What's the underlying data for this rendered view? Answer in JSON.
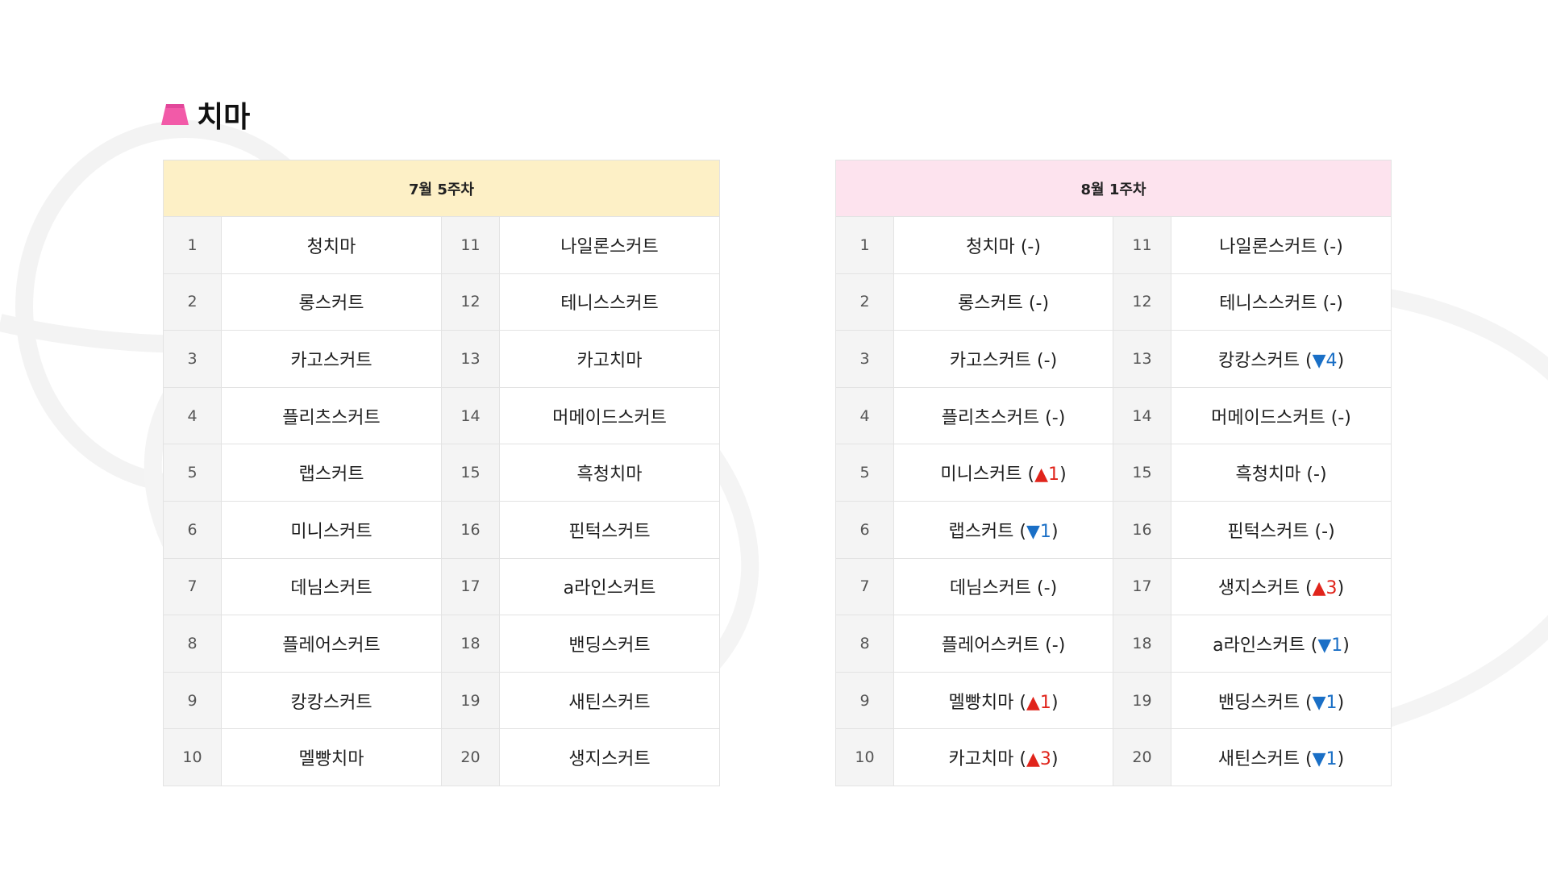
{
  "section": {
    "title": "치마",
    "icon": "skirt-icon",
    "icon_color": "#f25aa8"
  },
  "colors": {
    "left_header_bg": "#fdf0c6",
    "right_header_bg": "#fde3ee",
    "up": "#e0241b",
    "down": "#1a6fc6"
  },
  "left_table": {
    "header": "7월 5주차",
    "rows": [
      {
        "rank_a": "1",
        "name_a": "청치마",
        "rank_b": "11",
        "name_b": "나일론스커트"
      },
      {
        "rank_a": "2",
        "name_a": "롱스커트",
        "rank_b": "12",
        "name_b": "테니스스커트"
      },
      {
        "rank_a": "3",
        "name_a": "카고스커트",
        "rank_b": "13",
        "name_b": "카고치마"
      },
      {
        "rank_a": "4",
        "name_a": "플리츠스커트",
        "rank_b": "14",
        "name_b": "머메이드스커트"
      },
      {
        "rank_a": "5",
        "name_a": "랩스커트",
        "rank_b": "15",
        "name_b": "흑청치마"
      },
      {
        "rank_a": "6",
        "name_a": "미니스커트",
        "rank_b": "16",
        "name_b": "핀턱스커트"
      },
      {
        "rank_a": "7",
        "name_a": "데님스커트",
        "rank_b": "17",
        "name_b": "a라인스커트"
      },
      {
        "rank_a": "8",
        "name_a": "플레어스커트",
        "rank_b": "18",
        "name_b": "밴딩스커트"
      },
      {
        "rank_a": "9",
        "name_a": "캉캉스커트",
        "rank_b": "19",
        "name_b": "새틴스커트"
      },
      {
        "rank_a": "10",
        "name_a": "멜빵치마",
        "rank_b": "20",
        "name_b": "생지스커트"
      }
    ]
  },
  "right_table": {
    "header": "8월 1주차",
    "rows": [
      {
        "rank_a": "1",
        "name_a": "청치마",
        "chg_a": "(-)",
        "dir_a": "none",
        "rank_b": "11",
        "name_b": "나일론스커트",
        "chg_b": "(-)",
        "dir_b": "none"
      },
      {
        "rank_a": "2",
        "name_a": "롱스커트",
        "chg_a": "(-)",
        "dir_a": "none",
        "rank_b": "12",
        "name_b": "테니스스커트",
        "chg_b": "(-)",
        "dir_b": "none"
      },
      {
        "rank_a": "3",
        "name_a": "카고스커트",
        "chg_a": "(-)",
        "dir_a": "none",
        "rank_b": "13",
        "name_b": "캉캉스커트",
        "chg_b": "▼4",
        "dir_b": "down"
      },
      {
        "rank_a": "4",
        "name_a": "플리츠스커트",
        "chg_a": "(-)",
        "dir_a": "none",
        "rank_b": "14",
        "name_b": "머메이드스커트",
        "chg_b": "(-)",
        "dir_b": "none"
      },
      {
        "rank_a": "5",
        "name_a": "미니스커트",
        "chg_a": "▲1",
        "dir_a": "up",
        "rank_b": "15",
        "name_b": "흑청치마",
        "chg_b": "(-)",
        "dir_b": "none"
      },
      {
        "rank_a": "6",
        "name_a": "랩스커트",
        "chg_a": "▼1",
        "dir_a": "down",
        "rank_b": "16",
        "name_b": "핀턱스커트",
        "chg_b": "(-)",
        "dir_b": "none"
      },
      {
        "rank_a": "7",
        "name_a": "데님스커트",
        "chg_a": "(-)",
        "dir_a": "none",
        "rank_b": "17",
        "name_b": "생지스커트",
        "chg_b": "▲3",
        "dir_b": "up"
      },
      {
        "rank_a": "8",
        "name_a": "플레어스커트",
        "chg_a": "(-)",
        "dir_a": "none",
        "rank_b": "18",
        "name_b": "a라인스커트",
        "chg_b": "▼1",
        "dir_b": "down"
      },
      {
        "rank_a": "9",
        "name_a": "멜빵치마",
        "chg_a": "▲1",
        "dir_a": "up",
        "rank_b": "19",
        "name_b": "밴딩스커트",
        "chg_b": "▼1",
        "dir_b": "down"
      },
      {
        "rank_a": "10",
        "name_a": "카고치마",
        "chg_a": "▲3",
        "dir_a": "up",
        "rank_b": "20",
        "name_b": "새틴스커트",
        "chg_b": "▼1",
        "dir_b": "down"
      }
    ]
  }
}
